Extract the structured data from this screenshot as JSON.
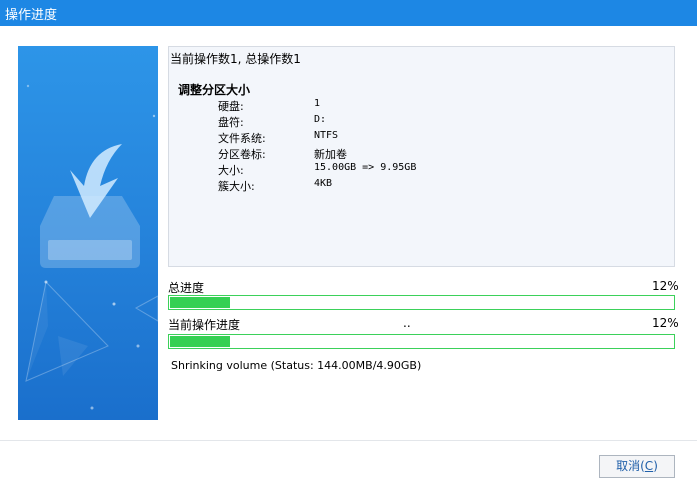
{
  "window": {
    "title": "操作进度"
  },
  "info": {
    "header": "当前操作数1, 总操作数1",
    "operation_title": "调整分区大小",
    "rows": [
      {
        "key": "硬盘:",
        "value": "1"
      },
      {
        "key": "盘符:",
        "value": "D:"
      },
      {
        "key": "文件系统:",
        "value": "NTFS"
      },
      {
        "key": "分区卷标:",
        "value": "新加卷"
      },
      {
        "key": "大小:",
        "value": "15.00GB => 9.95GB"
      },
      {
        "key": "簇大小:",
        "value": "4KB"
      }
    ]
  },
  "progress": {
    "total_label": "总进度",
    "total_percent_text": "12%",
    "total_value": 0.12,
    "current_label": "当前操作进度",
    "current_dots": "..",
    "current_percent_text": "12%",
    "current_value": 0.12,
    "bar_color": "#35d053"
  },
  "status_text": "Shrinking volume (Status: 144.00MB/4.90GB)",
  "buttons": {
    "cancel_label": "取消(",
    "cancel_hotkey": "C",
    "cancel_suffix": ")"
  },
  "colors": {
    "titlebar": "#1d87e4",
    "illustration": "#2583db"
  },
  "icons": {
    "illustration": "download-to-drive-icon"
  }
}
